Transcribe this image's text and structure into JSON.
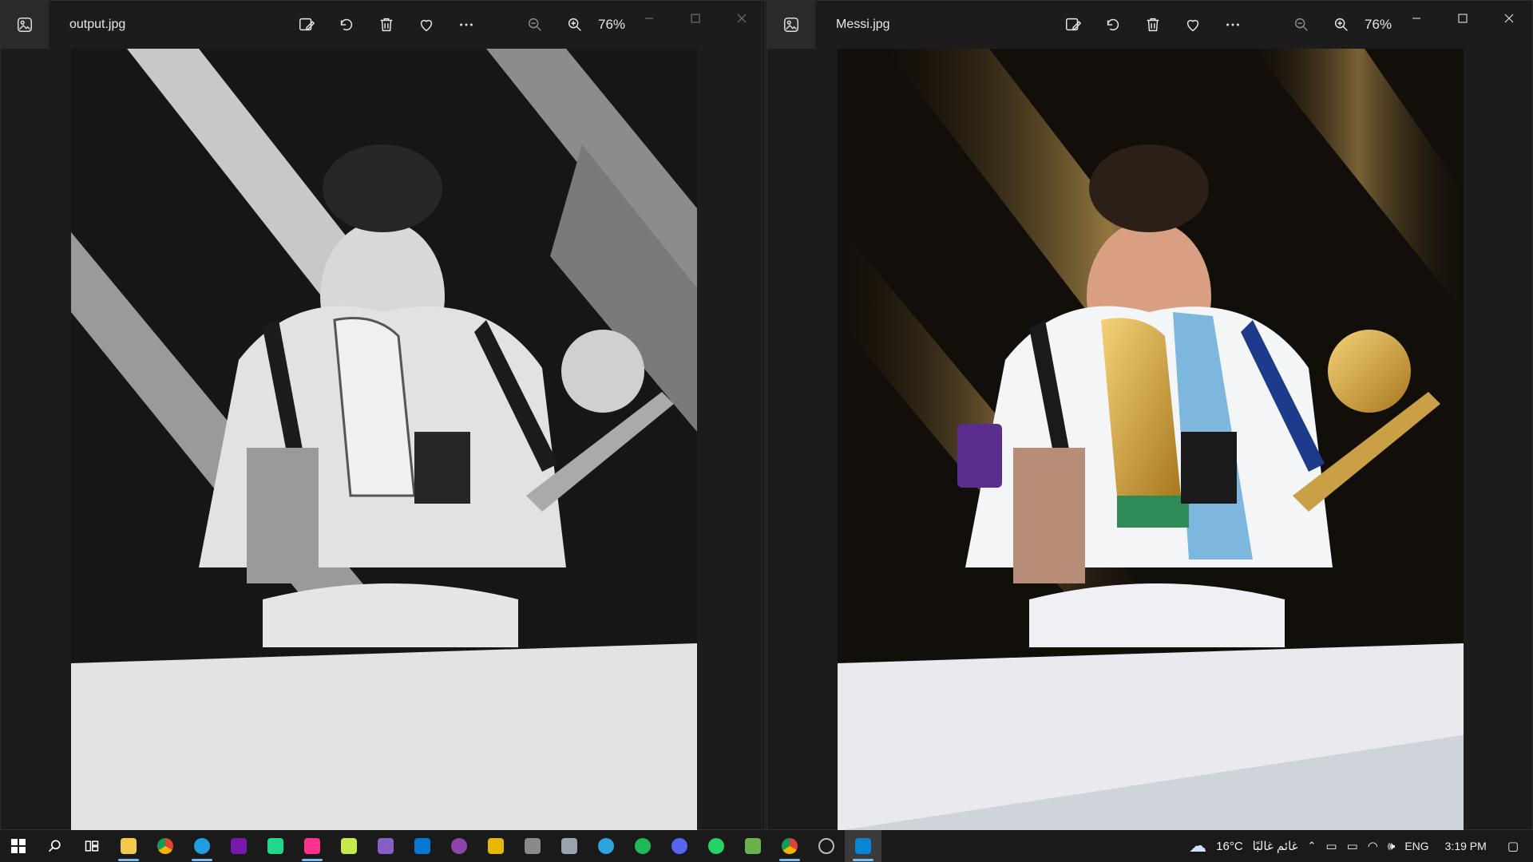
{
  "windows": [
    {
      "filename": "output.jpg",
      "zoom": "76%",
      "style": "grayscale"
    },
    {
      "filename": "Messi.jpg",
      "zoom": "76%",
      "style": "color"
    }
  ],
  "taskbar": {
    "apps": [
      "start-icon",
      "search-icon",
      "task-view-icon",
      "file-explorer-icon",
      "chrome-icon",
      "edge-icon",
      "onenote-icon",
      "pycharm-ce-icon",
      "jetbrains-icon",
      "pycharm-icon",
      "visual-studio-icon",
      "vscode-icon",
      "github-desktop-icon",
      "sticky-app-icon",
      "calculator-icon",
      "camera-icon",
      "telegram-icon",
      "spotify-icon",
      "discord-icon",
      "whatsapp-icon",
      "notepad-icon",
      "chrome-alt-icon",
      "clock-app-icon",
      "photos-icon"
    ],
    "weather_temp": "16°C",
    "weather_text": "غائم غالبًا",
    "language": "ENG",
    "time": "3:19 PM"
  }
}
